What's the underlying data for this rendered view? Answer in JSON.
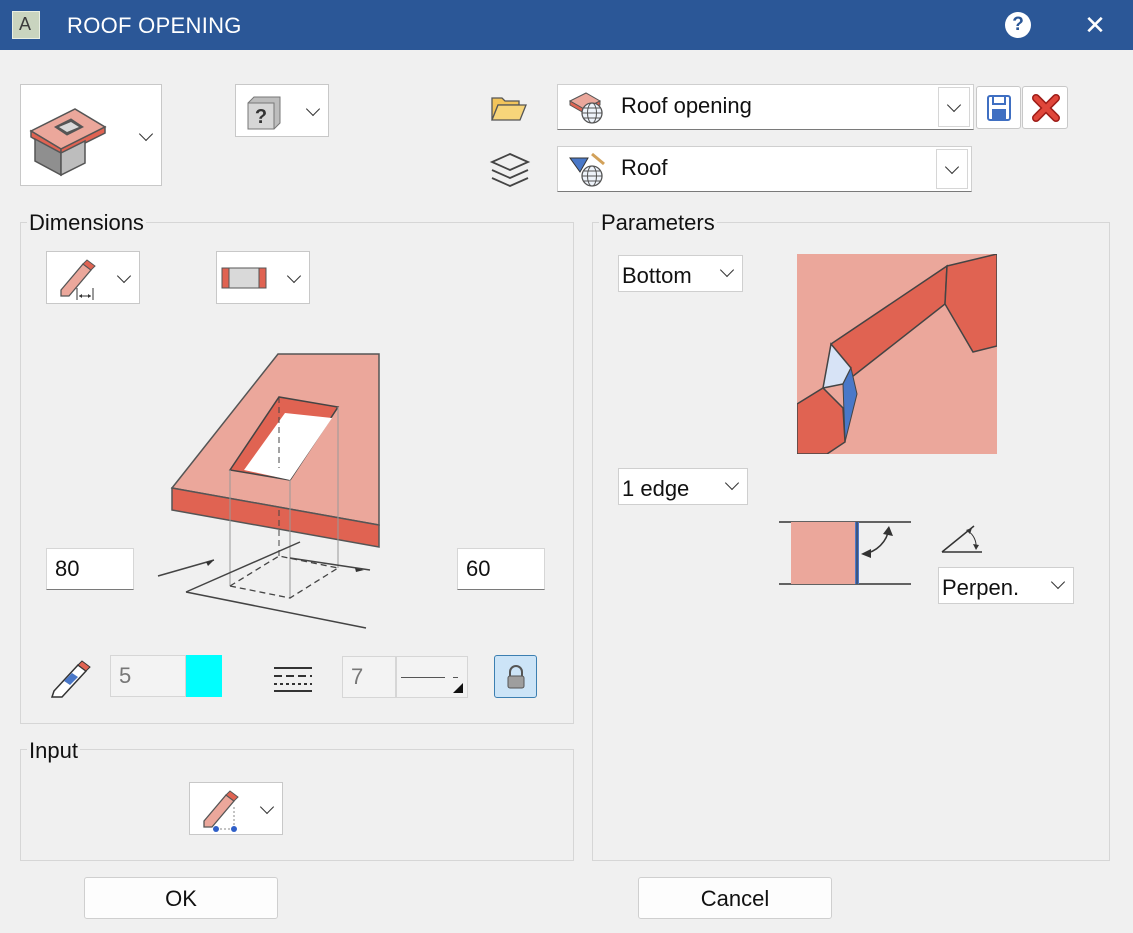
{
  "window": {
    "title": "ROOF OPENING",
    "app_icon_letter": "A"
  },
  "favorites": {
    "template_value": "Roof opening",
    "layer_value": "Roof"
  },
  "dimensions": {
    "label": "Dimensions",
    "left_value": "80",
    "right_value": "60",
    "pen_value": "5",
    "pen_color": "#00ffff",
    "line_value": "7"
  },
  "parameters": {
    "label": "Parameters",
    "position_value": "Bottom",
    "edge_value": "1 edge",
    "angle_value": "Perpen."
  },
  "input": {
    "label": "Input"
  },
  "buttons": {
    "ok": "OK",
    "cancel": "Cancel"
  },
  "colors": {
    "title_bar": "#2b5797",
    "roof_light": "#eba79b",
    "roof_dark": "#e06352",
    "accent_blue": "#4a78c8"
  }
}
